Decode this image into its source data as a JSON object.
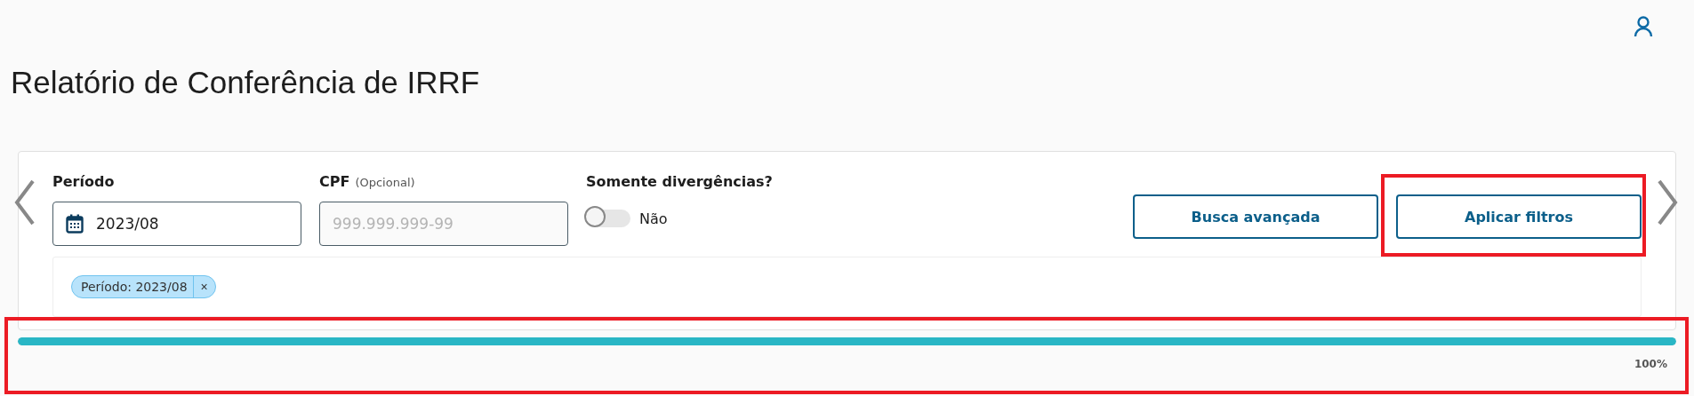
{
  "title": "Relatório de Conferência de IRRF",
  "filters": {
    "period": {
      "label": "Período",
      "value": "2023/08"
    },
    "cpf": {
      "label": "CPF",
      "hint": "(Opcional)",
      "placeholder": "999.999.999-99"
    },
    "divergences": {
      "label": "Somente divergências?",
      "on": false,
      "state_text": "Não"
    },
    "buttons": [
      {
        "label": "Busca avançada",
        "highlighted": false
      },
      {
        "label": "Aplicar filtros",
        "highlighted": true
      }
    ],
    "tags": [
      {
        "label": "Período: 2023/08",
        "close": "×"
      }
    ]
  },
  "progress": {
    "level": 1,
    "reading": "100%",
    "highlighted": true
  }
}
